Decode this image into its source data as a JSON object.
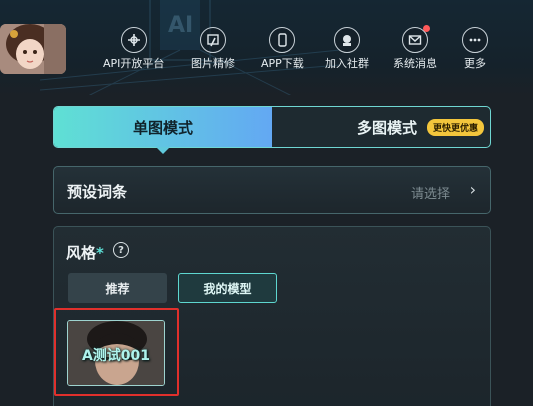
{
  "nav": {
    "items": [
      {
        "label": "API开放平台",
        "icon": "api-icon"
      },
      {
        "label": "图片精修",
        "icon": "image-edit-icon"
      },
      {
        "label": "APP下载",
        "icon": "phone-icon"
      },
      {
        "label": "加入社群",
        "icon": "community-icon"
      },
      {
        "label": "系统消息",
        "icon": "mail-icon"
      },
      {
        "label": "更多",
        "icon": "more-icon"
      }
    ]
  },
  "mode": {
    "single": "单图模式",
    "multi": "多图模式",
    "promo": "更快更优惠"
  },
  "preset": {
    "label": "预设词条",
    "placeholder": "请选择"
  },
  "style": {
    "title": "风格",
    "asterisk": "*",
    "help": "?",
    "tabs": {
      "recommended": "推荐",
      "mine": "我的模型"
    },
    "models": [
      {
        "name": "A测试001"
      }
    ]
  },
  "colors": {
    "accent": "#5ee0d7",
    "tab_gradient_start": "#5fe0d4",
    "tab_gradient_end": "#63a8f3",
    "highlight": "#e0302c",
    "promo": "#f3c63c"
  }
}
